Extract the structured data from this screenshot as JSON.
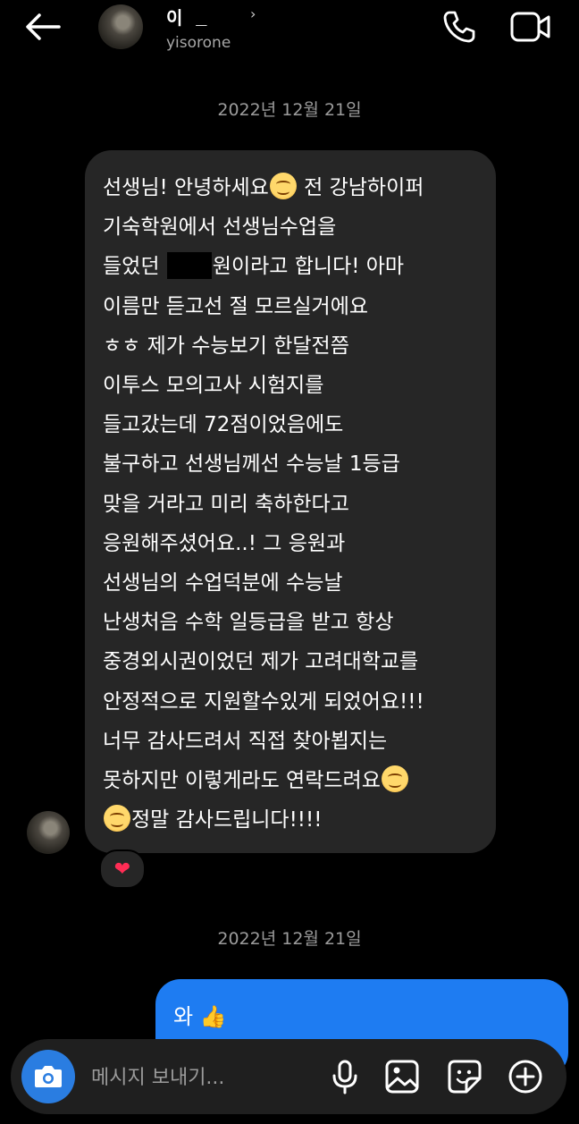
{
  "header": {
    "name": "이  님",
    "username": "yisorone"
  },
  "thread": {
    "date_1": "2022년 12월 21일",
    "date_2": "2022년 12월 21일",
    "incoming": {
      "lines": [
        [
          "선생님! 안녕하세요",
          "emoji",
          " 전 강남하이퍼"
        ],
        [
          "기숙학원에서 선생님수업을"
        ],
        [
          "들었던 ",
          "redacted",
          "원이라고 합니다! 아마"
        ],
        [
          "이름만 듣고선 절 모르실거에요"
        ],
        [
          "ㅎㅎ 제가 수능보기 한달전쯤"
        ],
        [
          "이투스 모의고사 시험지를"
        ],
        [
          "들고갔는데 72점이었음에도"
        ],
        [
          "불구하고 선생님께선 수능날 1등급"
        ],
        [
          "맞을 거라고 미리 축하한다고"
        ],
        [
          "응원해주셨어요..! 그 응원과"
        ],
        [
          "선생님의 수업덕분에 수능날"
        ],
        [
          "난생처음 수학 일등급을 받고 항상"
        ],
        [
          "중경외시권이었던 제가 고려대학교를"
        ],
        [
          "안정적으로 지원할수있게 되었어요!!!"
        ],
        [
          "너무 감사드려서 직접 찾아뵙지는"
        ],
        [
          "못하지만 이렇게라도 연락드려요",
          "emoji"
        ],
        [
          "emoji",
          "정말 감사드립니다!!!!"
        ]
      ],
      "reaction": "❤",
      "emoji_icon": "smiling-face-emoji"
    },
    "outgoing": {
      "text": "와 👍"
    }
  },
  "composer": {
    "placeholder": "메시지 보내기..."
  },
  "colors": {
    "background": "#000000",
    "incoming_bubble": "#262626",
    "outgoing_bubble": "#1e7cf2",
    "camera_button": "#2a7de1",
    "muted_text": "#9b9b9b"
  },
  "icons": [
    "back-arrow-icon",
    "phone-icon",
    "video-icon",
    "camera-icon",
    "mic-icon",
    "gallery-icon",
    "sticker-icon",
    "plus-icon",
    "heart-icon"
  ]
}
